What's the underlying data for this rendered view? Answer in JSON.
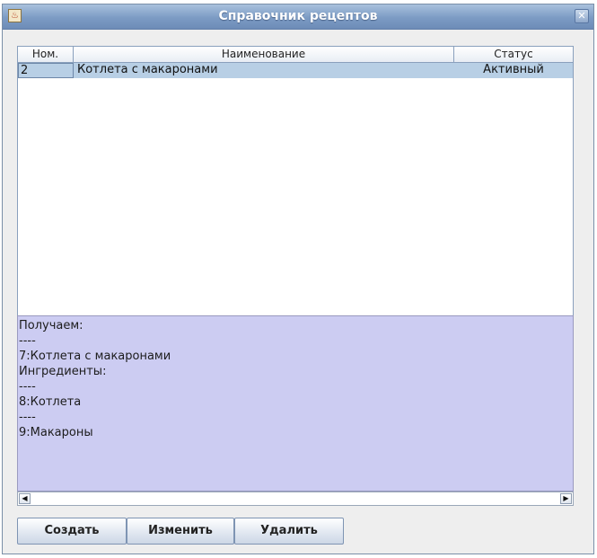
{
  "window": {
    "title": "Справочник рецептов",
    "app_icon_glyph": "♨",
    "close_glyph": "✕"
  },
  "table": {
    "columns": [
      "Ном.",
      "Наименование",
      "Статус"
    ],
    "rows": [
      {
        "num": "2",
        "name": "Котлета с макаронами",
        "status": "Активный",
        "selected": true
      }
    ]
  },
  "details": {
    "lines": [
      "Получаем:",
      "----",
      "7:Котлета с макаронами",
      "Ингредиенты:",
      "----",
      "8:Котлета",
      "----",
      "9:Макароны"
    ]
  },
  "scrollbar": {
    "left_glyph": "◀",
    "right_glyph": "▶"
  },
  "buttons": {
    "create": "Создать",
    "edit": "Изменить",
    "delete": "Удалить"
  },
  "colors": {
    "title_bar": "#7c9bc4",
    "selected_row": "#b8cfe5",
    "details_background": "#ccccf2"
  }
}
